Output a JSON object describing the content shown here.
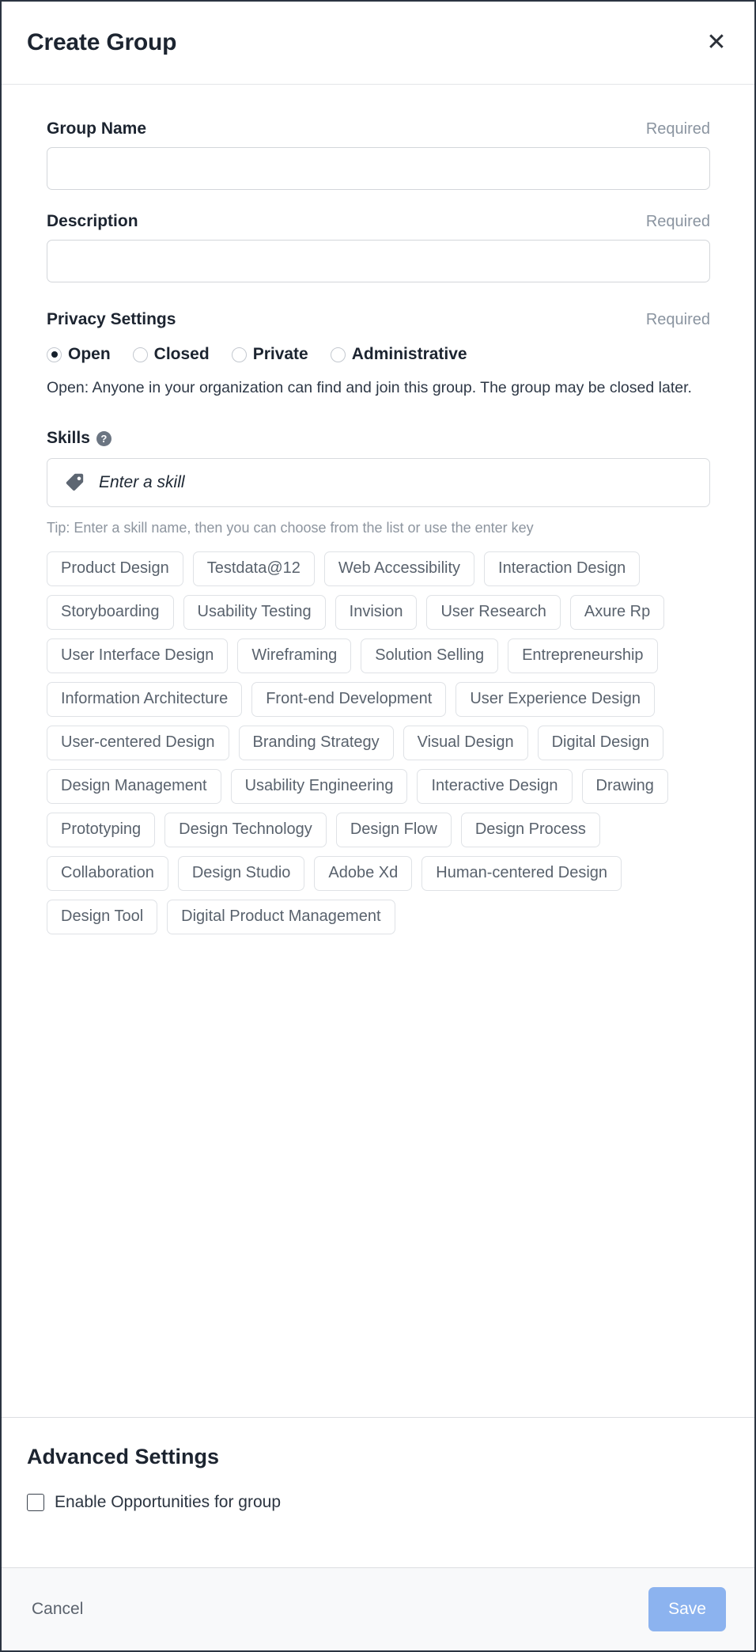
{
  "header": {
    "title": "Create Group",
    "close_label": "✕"
  },
  "form": {
    "group_name": {
      "label": "Group Name",
      "required_label": "Required",
      "value": "",
      "placeholder": ""
    },
    "description": {
      "label": "Description",
      "required_label": "Required",
      "value": "",
      "placeholder": ""
    },
    "privacy": {
      "label": "Privacy Settings",
      "required_label": "Required",
      "options": [
        {
          "label": "Open",
          "checked": true
        },
        {
          "label": "Closed",
          "checked": false
        },
        {
          "label": "Private",
          "checked": false
        },
        {
          "label": "Administrative",
          "checked": false
        }
      ],
      "description": "Open: Anyone in your organization can find and join this group. The group may be closed later."
    },
    "skills": {
      "label": "Skills",
      "help_icon": "help-circle-icon",
      "input_icon": "tag-icon",
      "placeholder": "Enter a skill",
      "value": "",
      "tip": "Tip: Enter a skill name, then you can choose from the list or use the enter key",
      "suggestions": [
        "Product Design",
        "Testdata@12",
        "Web Accessibility",
        "Interaction Design",
        "Storyboarding",
        "Usability Testing",
        "Invision",
        "User Research",
        "Axure Rp",
        "User Interface Design",
        "Wireframing",
        "Solution Selling",
        "Entrepreneurship",
        "Information Architecture",
        "Front-end Development",
        "User Experience Design",
        "User-centered Design",
        "Branding Strategy",
        "Visual Design",
        "Digital Design",
        "Design Management",
        "Usability Engineering",
        "Interactive Design",
        "Drawing",
        "Prototyping",
        "Design Technology",
        "Design Flow",
        "Design Process",
        "Collaboration",
        "Design Studio",
        "Adobe Xd",
        "Human-centered Design",
        "Design Tool",
        "Digital Product Management"
      ]
    }
  },
  "advanced": {
    "title": "Advanced Settings",
    "checkbox_label": "Enable Opportunities for group",
    "checkbox_checked": false
  },
  "footer": {
    "cancel_label": "Cancel",
    "save_label": "Save"
  },
  "colors": {
    "accent": "#8cb3ef",
    "text": "#1c2430",
    "muted": "#8a94a0",
    "chip_text": "#59626d",
    "border": "#d3d6da",
    "footer_bg": "#f8f9fa"
  }
}
